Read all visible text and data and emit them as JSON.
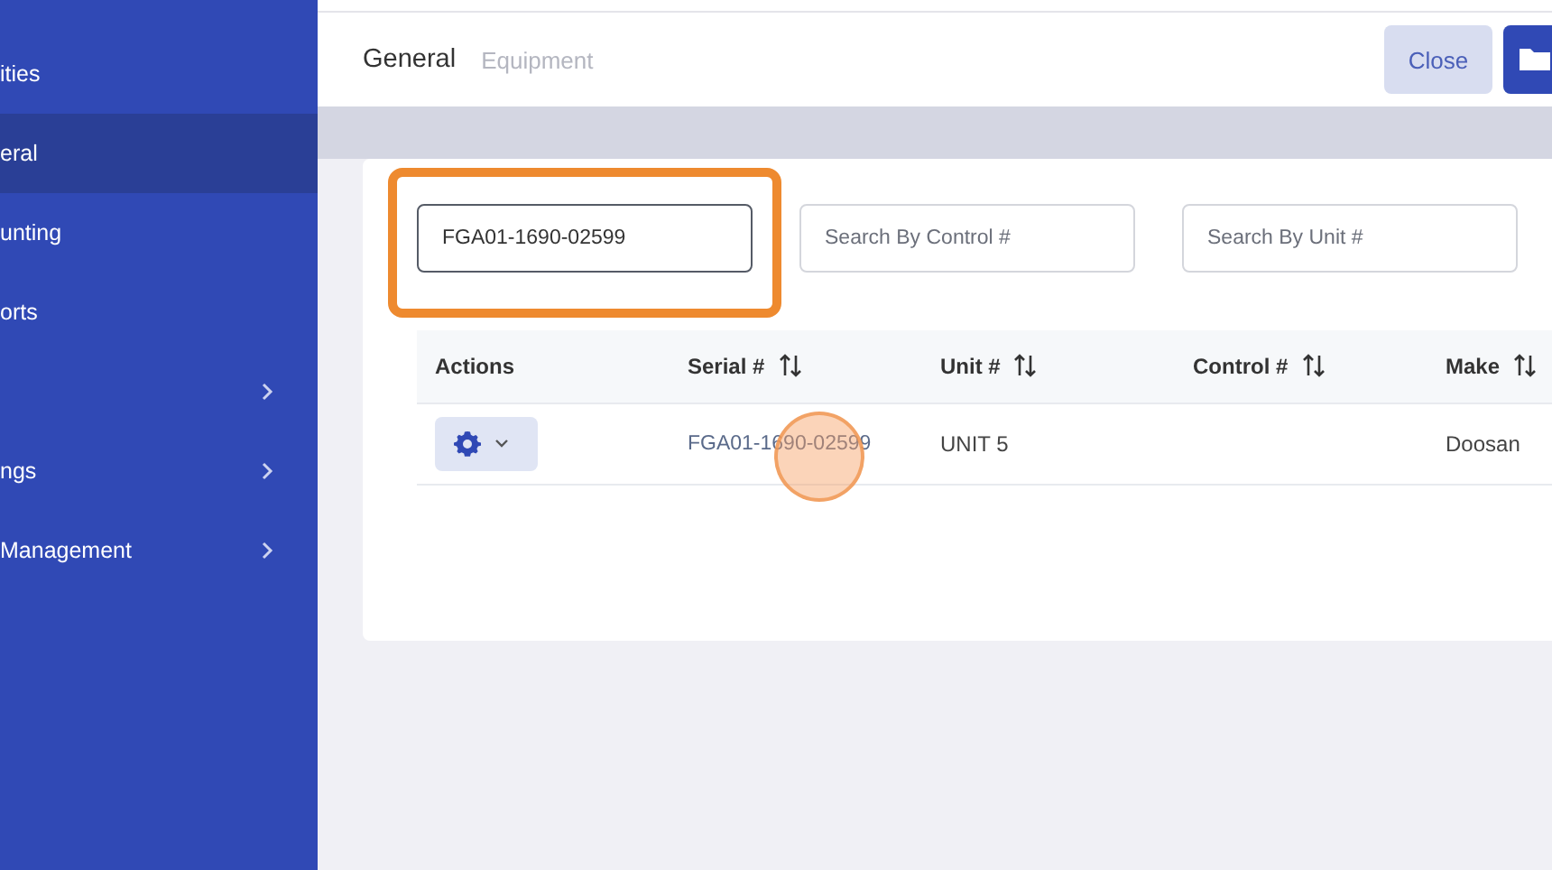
{
  "sidebar": {
    "items": [
      {
        "label": "ities",
        "selected": false,
        "has_children": false
      },
      {
        "label": "eral",
        "selected": true,
        "has_children": false
      },
      {
        "label": "unting",
        "selected": false,
        "has_children": false
      },
      {
        "label": "orts",
        "selected": false,
        "has_children": false
      },
      {
        "selected": false,
        "has_children": true
      },
      {
        "label": "ngs",
        "selected": false,
        "has_children": true
      },
      {
        "label": "Management",
        "selected": false,
        "has_children": true
      }
    ]
  },
  "header": {
    "breadcrumbs": [
      {
        "label": "General",
        "selected": true
      },
      {
        "label": "Equipment",
        "selected": false
      }
    ],
    "buttons": [
      {
        "kind": "text",
        "label": "Close"
      },
      {
        "kind": "folder"
      }
    ]
  },
  "filters": [
    {
      "value": "FGA01-1690-02599",
      "highlighted": true
    },
    {
      "placeholder": "Search By Control #",
      "highlighted": false
    },
    {
      "placeholder": "Search By Unit #",
      "highlighted": false
    }
  ],
  "table": {
    "columns": [
      {
        "label": "Actions",
        "sortable": false
      },
      {
        "label": "Serial #",
        "sortable": true
      },
      {
        "label": "Unit #",
        "sortable": true
      },
      {
        "label": "Control #",
        "sortable": true
      },
      {
        "label": "Make",
        "sortable": true
      }
    ],
    "rows": [
      {
        "serial": "FGA01-1690-02599",
        "unit": "UNIT 5",
        "make": "Doosan"
      }
    ]
  },
  "click_marker": {
    "shown": true
  }
}
